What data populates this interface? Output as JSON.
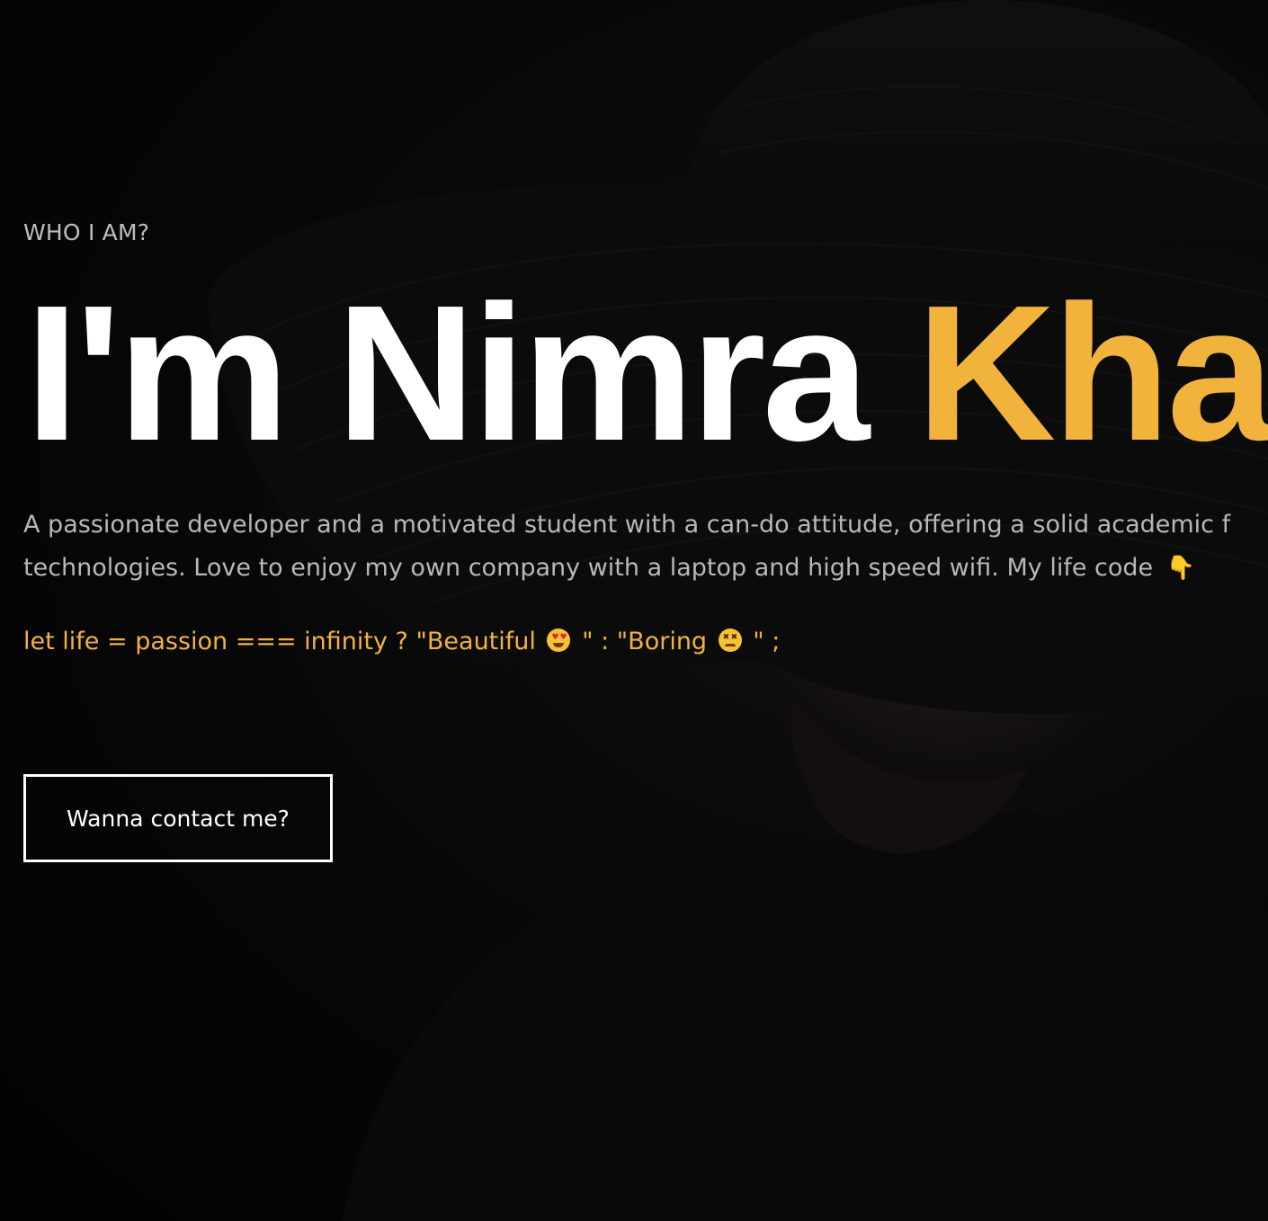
{
  "hero": {
    "eyebrow": "WHO I AM?",
    "name_first": "I'm Nimra",
    "name_last": "Khan",
    "bio_line_1": "A passionate developer and a motivated student with a can-do attitude, offering a solid academic f",
    "bio_line_2": "technologies. Love to enjoy my own company with a laptop and high speed wifi. My life code",
    "bio_pointer_icon": "pointing-down-hand-icon",
    "code": {
      "part_1": "let life = passion === infinity ? \"Beautiful",
      "part_2": "\" : \"Boring",
      "part_3": "\" ;",
      "emoji_1": "heart-eyes-emoji-icon",
      "emoji_2": "persevering-face-emoji-icon"
    },
    "contact_button_label": "Wanna contact me?"
  },
  "colors": {
    "accent": "#f2b33d",
    "background": "#0a0a0a",
    "text": "#ffffff",
    "muted_text": "#b8b8b8"
  }
}
